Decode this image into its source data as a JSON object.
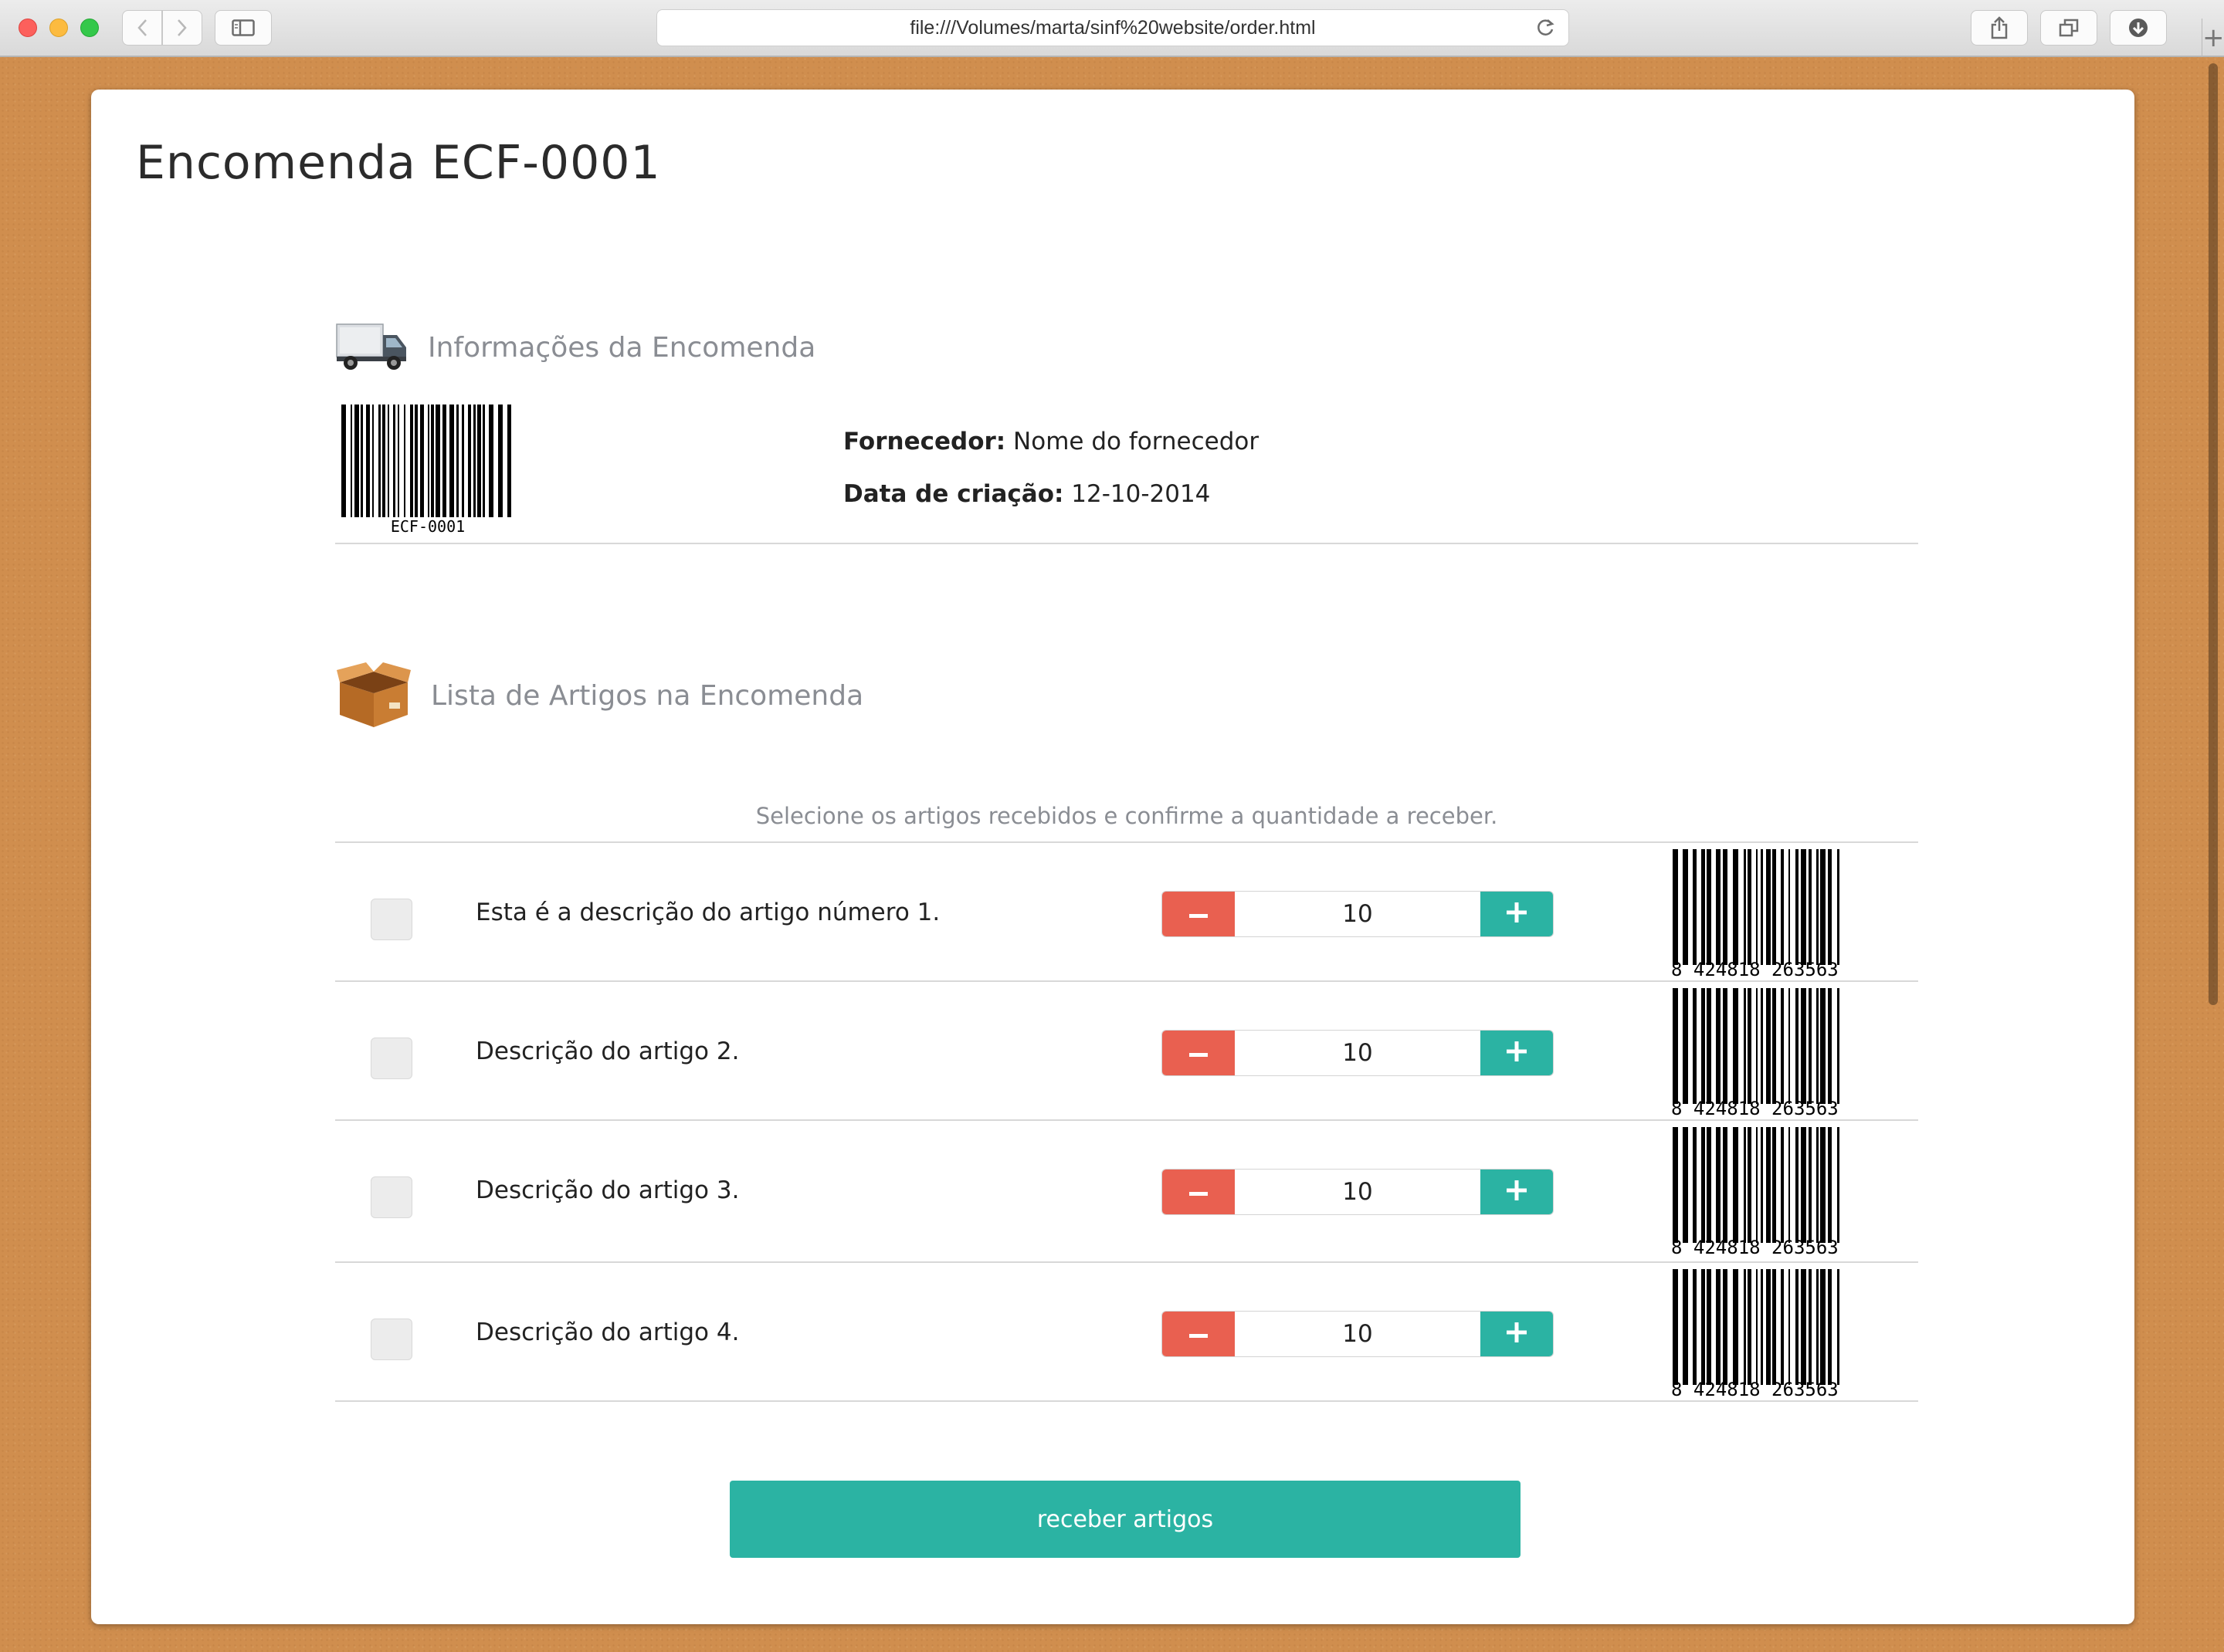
{
  "browser": {
    "url": "file:///Volumes/marta/sinf%20website/order.html",
    "new_tab_label": "+"
  },
  "page": {
    "title": "Encomenda ECF-0001"
  },
  "order_info": {
    "heading": "Informações da Encomenda",
    "icon": "delivery-truck-icon",
    "barcode_caption": "ECF-0001",
    "supplier_label": "Fornecedor:",
    "supplier_value": "Nome do fornecedor",
    "created_label": "Data de criação:",
    "created_value": "12-10-2014"
  },
  "items_section": {
    "heading": "Lista de Artigos na Encomenda",
    "icon": "cardboard-box-icon",
    "instructions": "Selecione os artigos recebidos e confirme a quantidade a receber."
  },
  "items": [
    {
      "description": "Esta é a descrição do artigo número 1.",
      "quantity": "10",
      "barcode": "8 424818 263563",
      "checked": false
    },
    {
      "description": "Descrição do artigo 2.",
      "quantity": "10",
      "barcode": "8 424818 263563",
      "checked": false
    },
    {
      "description": "Descrição do artigo 3.",
      "quantity": "10",
      "barcode": "8 424818 263563",
      "checked": false
    },
    {
      "description": "Descrição do artigo 4.",
      "quantity": "10",
      "barcode": "8 424818 263563",
      "checked": false
    }
  ],
  "actions": {
    "receive_label": "receber artigos"
  },
  "colors": {
    "accent_teal": "#2bb3a3",
    "minus_red": "#e96050",
    "background_cork": "#d08e4e"
  }
}
